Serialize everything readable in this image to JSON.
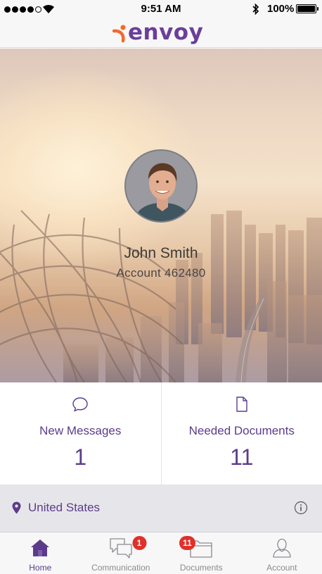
{
  "status_bar": {
    "time": "9:51 AM",
    "battery": "100%",
    "icons": [
      "signal-dots-icon",
      "wifi-icon",
      "bluetooth-icon",
      "battery-icon"
    ]
  },
  "header": {
    "brand": "envoy",
    "brand_color": "#6a3f99",
    "accent_color": "#f26a2c"
  },
  "profile": {
    "name": "John Smith",
    "account": "Account 462480"
  },
  "stats": [
    {
      "label": "New Messages",
      "value": "1",
      "icon": "chat-bubble-icon"
    },
    {
      "label": "Needed Documents",
      "value": "11",
      "icon": "document-icon"
    }
  ],
  "location": {
    "country": "United States",
    "icons": [
      "location-pin-icon",
      "info-icon"
    ]
  },
  "tabs": [
    {
      "label": "Home",
      "icon": "home-icon",
      "active": true
    },
    {
      "label": "Communication",
      "icon": "chat-bubbles-icon",
      "badge": "1"
    },
    {
      "label": "Documents",
      "icon": "folder-icon",
      "badge": "11"
    },
    {
      "label": "Account",
      "icon": "person-icon"
    }
  ],
  "colors": {
    "primary": "#5b3c8a",
    "badge": "#e0302a",
    "inactive_tab": "#8b8b90"
  }
}
